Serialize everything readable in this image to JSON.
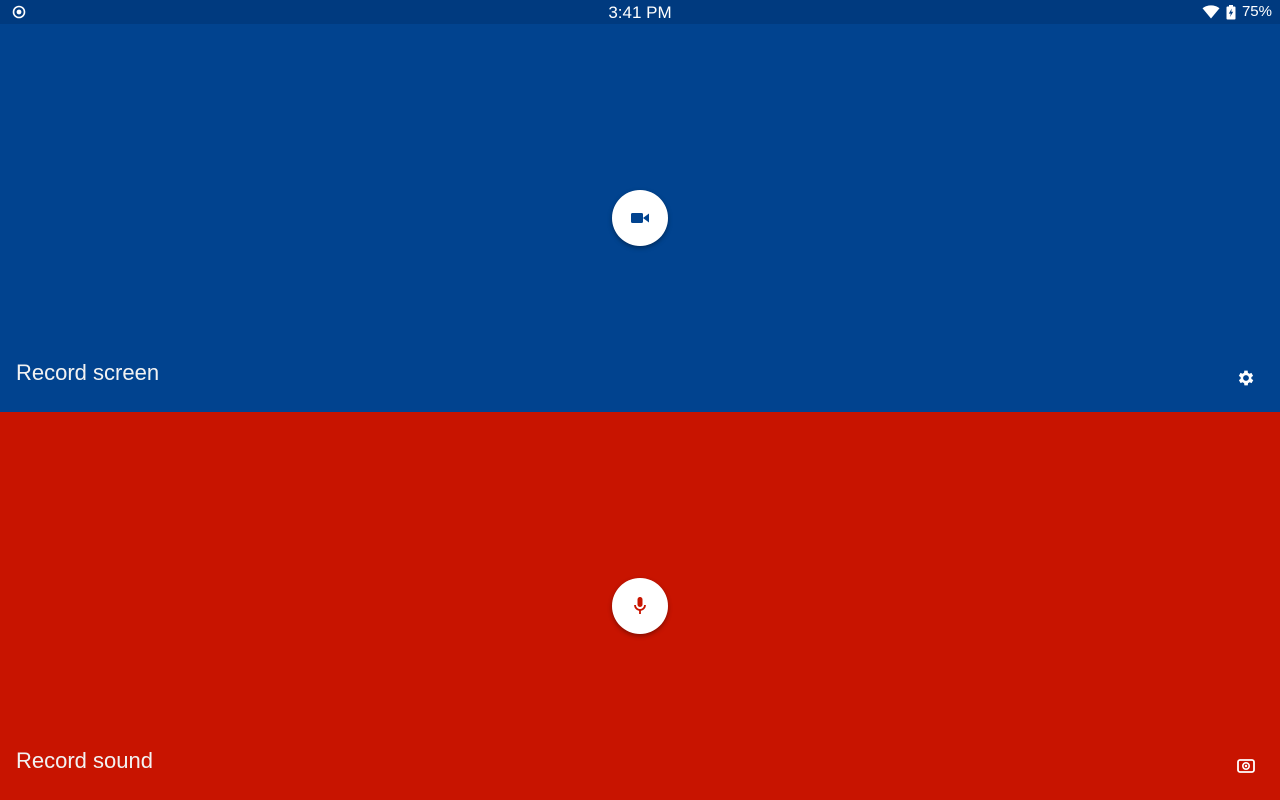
{
  "status_bar": {
    "time": "3:41 PM",
    "battery_percent": "75%",
    "left_icon": "record-indicator-icon",
    "icons": [
      "wifi-icon",
      "battery-charging-icon"
    ]
  },
  "panels": {
    "screen": {
      "label": "Record screen",
      "color": "#01438f",
      "fab_icon": "videocam-icon",
      "corner_icon": "gear-icon"
    },
    "sound": {
      "label": "Record sound",
      "color": "#c81400",
      "fab_icon": "mic-icon",
      "corner_icon": "radio-icon"
    }
  }
}
